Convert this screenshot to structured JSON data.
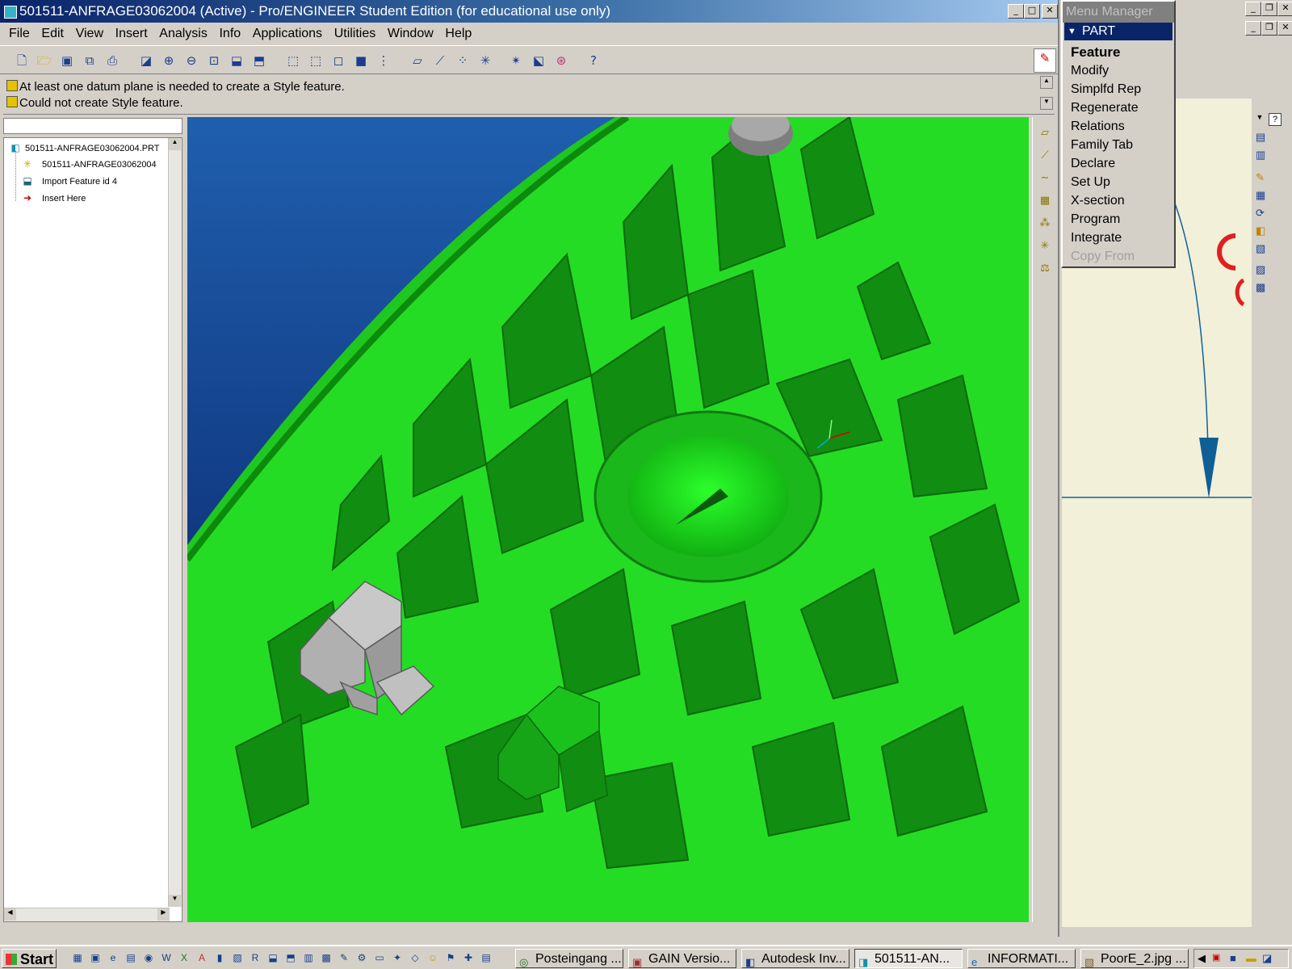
{
  "window": {
    "title": "501511-ANFRAGE03062004 (Active) - Pro/ENGINEER Student Edition (for educational use only)"
  },
  "menu": [
    "File",
    "Edit",
    "View",
    "Insert",
    "Analysis",
    "Info",
    "Applications",
    "Utilities",
    "Window",
    "Help"
  ],
  "messages": [
    "At least one datum plane is needed to create a Style feature.",
    "Could not create Style feature."
  ],
  "model_tree": {
    "items": [
      "501511-ANFRAGE03062004.PRT",
      "501511-ANFRAGE03062004",
      "Import Feature id 4",
      "Insert Here"
    ]
  },
  "menu_manager": {
    "title": "Menu Manager",
    "section": "PART",
    "items": [
      "Feature",
      "Modify",
      "Simplfd Rep",
      "Regenerate",
      "Relations",
      "Family Tab",
      "Declare",
      "Set Up",
      "X-section",
      "Program",
      "Integrate",
      "Copy From"
    ]
  },
  "taskbar": {
    "start": "Start",
    "tasks": [
      "Posteingang ...",
      "GAIN Versio...",
      "Autodesk Inv...",
      "501511-AN...",
      "INFORMATI...",
      "PoorE_2.jpg ..."
    ]
  },
  "colors": {
    "model_green": "#1fd81f",
    "background_blue": "#0a2c7a",
    "title_blue": "#0a246a"
  }
}
